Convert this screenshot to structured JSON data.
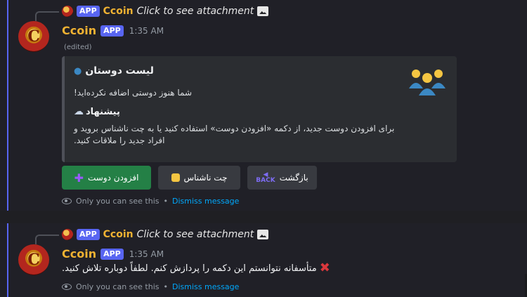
{
  "messages": [
    {
      "reply": {
        "tag": "APP",
        "name": "Ccoin",
        "text": "Click to see attachment"
      },
      "author": {
        "name": "Ccoin",
        "tag": "APP",
        "avatar_letter": "C"
      },
      "time": "1:35 AM",
      "edited": "(edited)",
      "embed": {
        "title": "لیست دوستان",
        "title_icon": "people-icon",
        "description": "شما هنوز دوستی اضافه نکرده‌اید!",
        "subtitle": "پیشنهاد",
        "subtitle_icon": "thought-bubble-icon",
        "body": "برای افزودن دوست جدید، از دکمه «افزودن دوست» استفاده کنید یا به چت ناشناس بروید و افراد جدید را ملاقات کنید.",
        "thumbnail_icon": "group-people-icon"
      },
      "buttons": [
        {
          "label": "افزودن دوست",
          "icon": "plus-icon",
          "color": "#248046"
        },
        {
          "label": "چت ناشناس",
          "icon": "mask-icon",
          "color": "#383a40"
        },
        {
          "label": "بازگشت",
          "icon": "back-icon",
          "icon_text": "BACK",
          "color": "#383a40"
        }
      ],
      "notice": {
        "text": "Only you can see this",
        "separator": "•",
        "dismiss": "Dismiss message"
      }
    },
    {
      "reply": {
        "tag": "APP",
        "name": "Ccoin",
        "text": "Click to see attachment"
      },
      "author": {
        "name": "Ccoin",
        "tag": "APP",
        "avatar_letter": "C"
      },
      "time": "1:35 AM",
      "content": "متأسفانه نتوانستم این دکمه را پردازش کنم. لطفاً دوباره تلاش کنید.",
      "content_icon": "x-icon",
      "notice": {
        "text": "Only you can see this",
        "separator": "•",
        "dismiss": "Dismiss message"
      }
    }
  ],
  "colors": {
    "author": "#f0b232",
    "app_tag": "#5865f2",
    "link": "#00a8fc",
    "success": "#248046",
    "danger": "#da373c"
  }
}
